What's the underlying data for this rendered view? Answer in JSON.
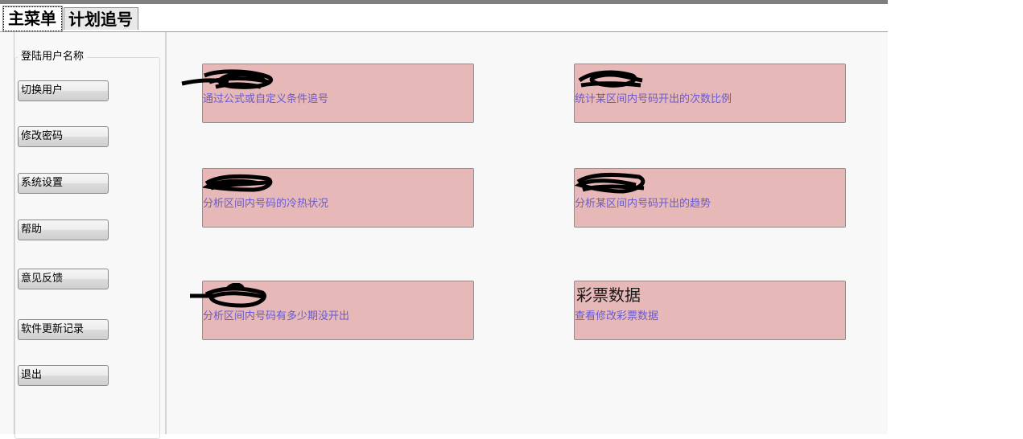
{
  "tabs": [
    {
      "label": "主菜单"
    },
    {
      "label": "计划追号"
    }
  ],
  "sidebar": {
    "group_title": "登陆用户名称",
    "buttons": [
      {
        "label": "切换用户"
      },
      {
        "label": "修改密码"
      },
      {
        "label": "系统设置"
      },
      {
        "label": "帮助"
      },
      {
        "label": "意见反馈"
      },
      {
        "label": "软件更新记录"
      },
      {
        "label": "退出"
      }
    ]
  },
  "cards": [
    {
      "title": "",
      "desc": "通过公式或自定义条件追号",
      "title_redacted": true
    },
    {
      "title": "",
      "desc": "统计某区间内号码开出的次数比例",
      "title_redacted": true
    },
    {
      "title": "",
      "desc": "分析区间内号码的冷热状况",
      "title_redacted": true
    },
    {
      "title": "",
      "desc": "分析某区间内号码开出的趋势",
      "title_redacted": true
    },
    {
      "title": "",
      "desc": "分析区间内号码有多少期没开出",
      "title_redacted": true
    },
    {
      "title": "彩票数据",
      "desc": "查看修改彩票数据",
      "title_redacted": false
    }
  ],
  "colors": {
    "card_bg": "#e6b8b7",
    "card_desc": "#6a5acd",
    "topbar": "#7f7f7f"
  }
}
